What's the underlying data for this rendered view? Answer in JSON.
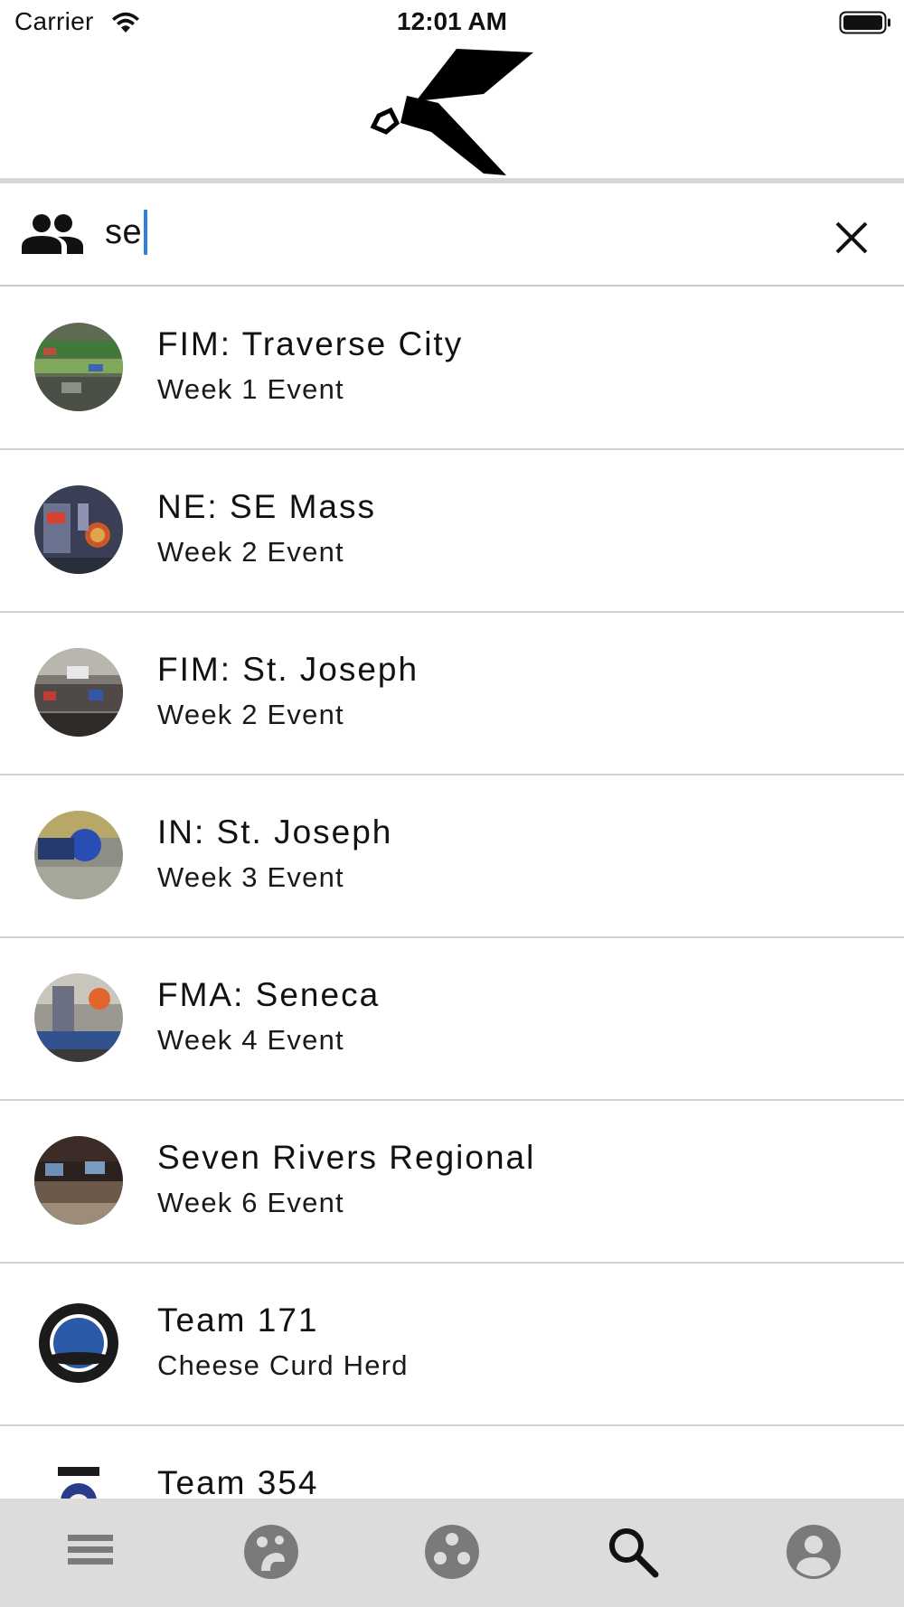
{
  "status_bar": {
    "carrier": "Carrier",
    "time": "12:01 AM",
    "icons": [
      "wifi-icon",
      "battery-icon"
    ]
  },
  "header": {
    "logo": "tba-lamp-logo"
  },
  "search": {
    "value": "se",
    "scope_icon": "people-icon",
    "clear_icon": "close-icon",
    "caret_color": "#2f7fe0"
  },
  "results": [
    {
      "title": "FIM: Traverse City",
      "subtitle": "Week 1 Event"
    },
    {
      "title": "NE: SE Mass",
      "subtitle": "Week 2 Event"
    },
    {
      "title": "FIM: St. Joseph",
      "subtitle": "Week 2 Event"
    },
    {
      "title": "IN: St. Joseph",
      "subtitle": "Week 3 Event"
    },
    {
      "title": "FMA: Seneca",
      "subtitle": "Week 4 Event"
    },
    {
      "title": "Seven Rivers Regional",
      "subtitle": "Week 6 Event"
    },
    {
      "title": "Team 171",
      "subtitle": "Cheese Curd Herd"
    },
    {
      "title": "Team 354",
      "subtitle": ""
    }
  ],
  "tab_bar": {
    "background": "#dcdcdc",
    "active_color": "#111111",
    "inactive_color": "#7a7a7a",
    "tabs": [
      {
        "icon": "list-icon",
        "active": false
      },
      {
        "icon": "team-icon",
        "active": false
      },
      {
        "icon": "events-icon",
        "active": false
      },
      {
        "icon": "search-icon",
        "active": true
      },
      {
        "icon": "account-icon",
        "active": false
      }
    ]
  }
}
